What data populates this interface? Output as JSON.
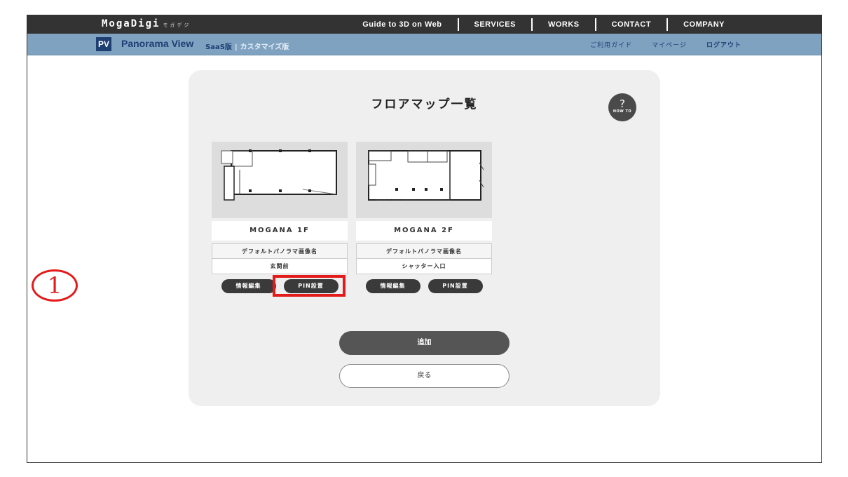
{
  "header": {
    "brand": "MogaDigi",
    "brand_sub": "モガデジ",
    "nav": [
      "Guide to 3D on Web",
      "SERVICES",
      "WORKS",
      "CONTACT",
      "COMPANY"
    ]
  },
  "subheader": {
    "badge": "PV",
    "title": "Panorama View",
    "saas": "SaaS版",
    "custom": "カスタマイズ版",
    "links": [
      "ご利用ガイド",
      "マイページ",
      "ログアウト"
    ]
  },
  "main": {
    "title": "フロアマップ一覧",
    "howto": {
      "q": "?",
      "label": "HOW TO"
    },
    "cards": [
      {
        "name": "MOGANA 1F",
        "info_header": "デフォルトパノラマ画像名",
        "info_value": "玄関前",
        "edit_label": "情報編集",
        "pin_label": "PIN設置"
      },
      {
        "name": "MOGANA 2F",
        "info_header": "デフォルトパノラマ画像名",
        "info_value": "シャッター入口",
        "edit_label": "情報編集",
        "pin_label": "PIN設置"
      }
    ],
    "add_label": "追加",
    "back_label": "戻る"
  },
  "annotation": {
    "number": "1"
  },
  "colors": {
    "topbar": "#333333",
    "subbar": "#7fa2c1",
    "brand_blue": "#1d3f73",
    "highlight_red": "#e31b1b",
    "panel": "#efefef"
  }
}
